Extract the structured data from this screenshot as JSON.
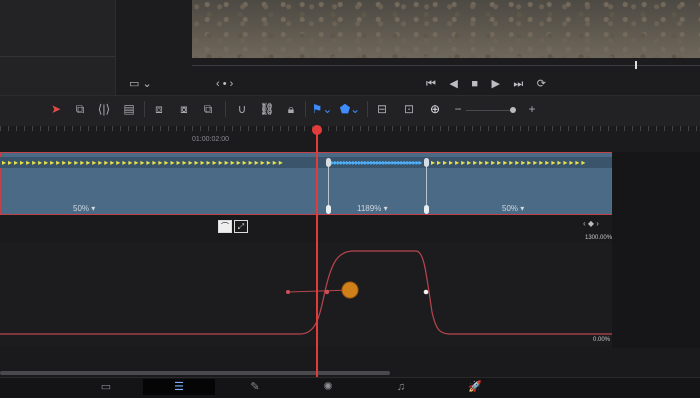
{
  "viewer": {
    "nav_prev": "‹",
    "nav_dot": "•",
    "nav_next": "›",
    "transport": [
      "⏮",
      "◀",
      "■",
      "▶",
      "⏭",
      "⟳"
    ]
  },
  "timeline": {
    "ruler_timecode": "01:00:02:00",
    "clip": {
      "segment_speeds": [
        "50%",
        "1189%",
        "50%"
      ],
      "dropdown_glyph": "▾"
    },
    "curve": {
      "top_value": "1300.00%",
      "bottom_value": "0.00%",
      "keyframe_nav": "‹ ◆ ›"
    }
  },
  "icons": {
    "selection": "arrow-select-icon",
    "trim": "trim-icon",
    "dynamic_trim": "dynamic-trim-icon",
    "blade": "blade-icon",
    "link": "link-icon",
    "lock": "lock-icon",
    "flag": "flag-icon",
    "marker": "marker-icon",
    "zoom": "zoom-icon"
  },
  "colors": {
    "playhead": "#e23b3b",
    "clip_fill": "#4a6a86",
    "clip_border": "#c0424a",
    "speed_arrows": "#e9e24a",
    "keyframe_orange": "#d0801a",
    "active_page": "#7fb0ff"
  },
  "pages": [
    "▭",
    "☰",
    "✎",
    "✺",
    "♫",
    "🚀"
  ]
}
